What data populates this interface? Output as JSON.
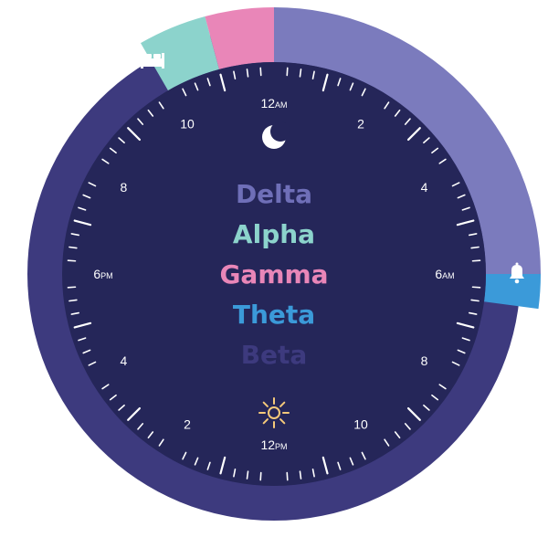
{
  "dial": {
    "labels": [
      {
        "hour": 0,
        "main": "12",
        "sub": "AM"
      },
      {
        "hour": 2,
        "main": "2",
        "sub": ""
      },
      {
        "hour": 4,
        "main": "4",
        "sub": ""
      },
      {
        "hour": 6,
        "main": "6",
        "sub": "AM"
      },
      {
        "hour": 8,
        "main": "8",
        "sub": ""
      },
      {
        "hour": 10,
        "main": "10",
        "sub": ""
      },
      {
        "hour": 12,
        "main": "12",
        "sub": "PM"
      },
      {
        "hour": 14,
        "main": "2",
        "sub": ""
      },
      {
        "hour": 16,
        "main": "4",
        "sub": ""
      },
      {
        "hour": 18,
        "main": "6",
        "sub": "PM"
      },
      {
        "hour": 20,
        "main": "8",
        "sub": ""
      },
      {
        "hour": 22,
        "main": "10",
        "sub": ""
      }
    ],
    "face_color": "#252659",
    "ring_color": "#3d3a7e"
  },
  "ring_segments": [
    {
      "name": "sleep-segment",
      "start_hour": 22.0,
      "end_hour": 23.0,
      "color": "#8cd3cc"
    },
    {
      "name": "pink-segment",
      "start_hour": 23.0,
      "end_hour": 24.0,
      "color": "#e986b8"
    },
    {
      "name": "light-sleep-segment",
      "start_hour": 0.0,
      "end_hour": 6.0,
      "color": "#7b7bbd"
    },
    {
      "name": "alarm-segment",
      "start_hour": 6.0,
      "end_hour": 6.5,
      "color": "#3b9ad9"
    }
  ],
  "icons": {
    "bed": "bed-icon",
    "alarm": "bell-icon",
    "night": "moon-icon",
    "day": "sun-icon"
  },
  "stages": [
    {
      "label": "Delta",
      "color": "#6f6fb8"
    },
    {
      "label": "Alpha",
      "color": "#8cd3cc"
    },
    {
      "label": "Gamma",
      "color": "#e986b8"
    },
    {
      "label": "Theta",
      "color": "#3b9ad9"
    },
    {
      "label": "Beta",
      "color": "#3d3a7e"
    }
  ]
}
